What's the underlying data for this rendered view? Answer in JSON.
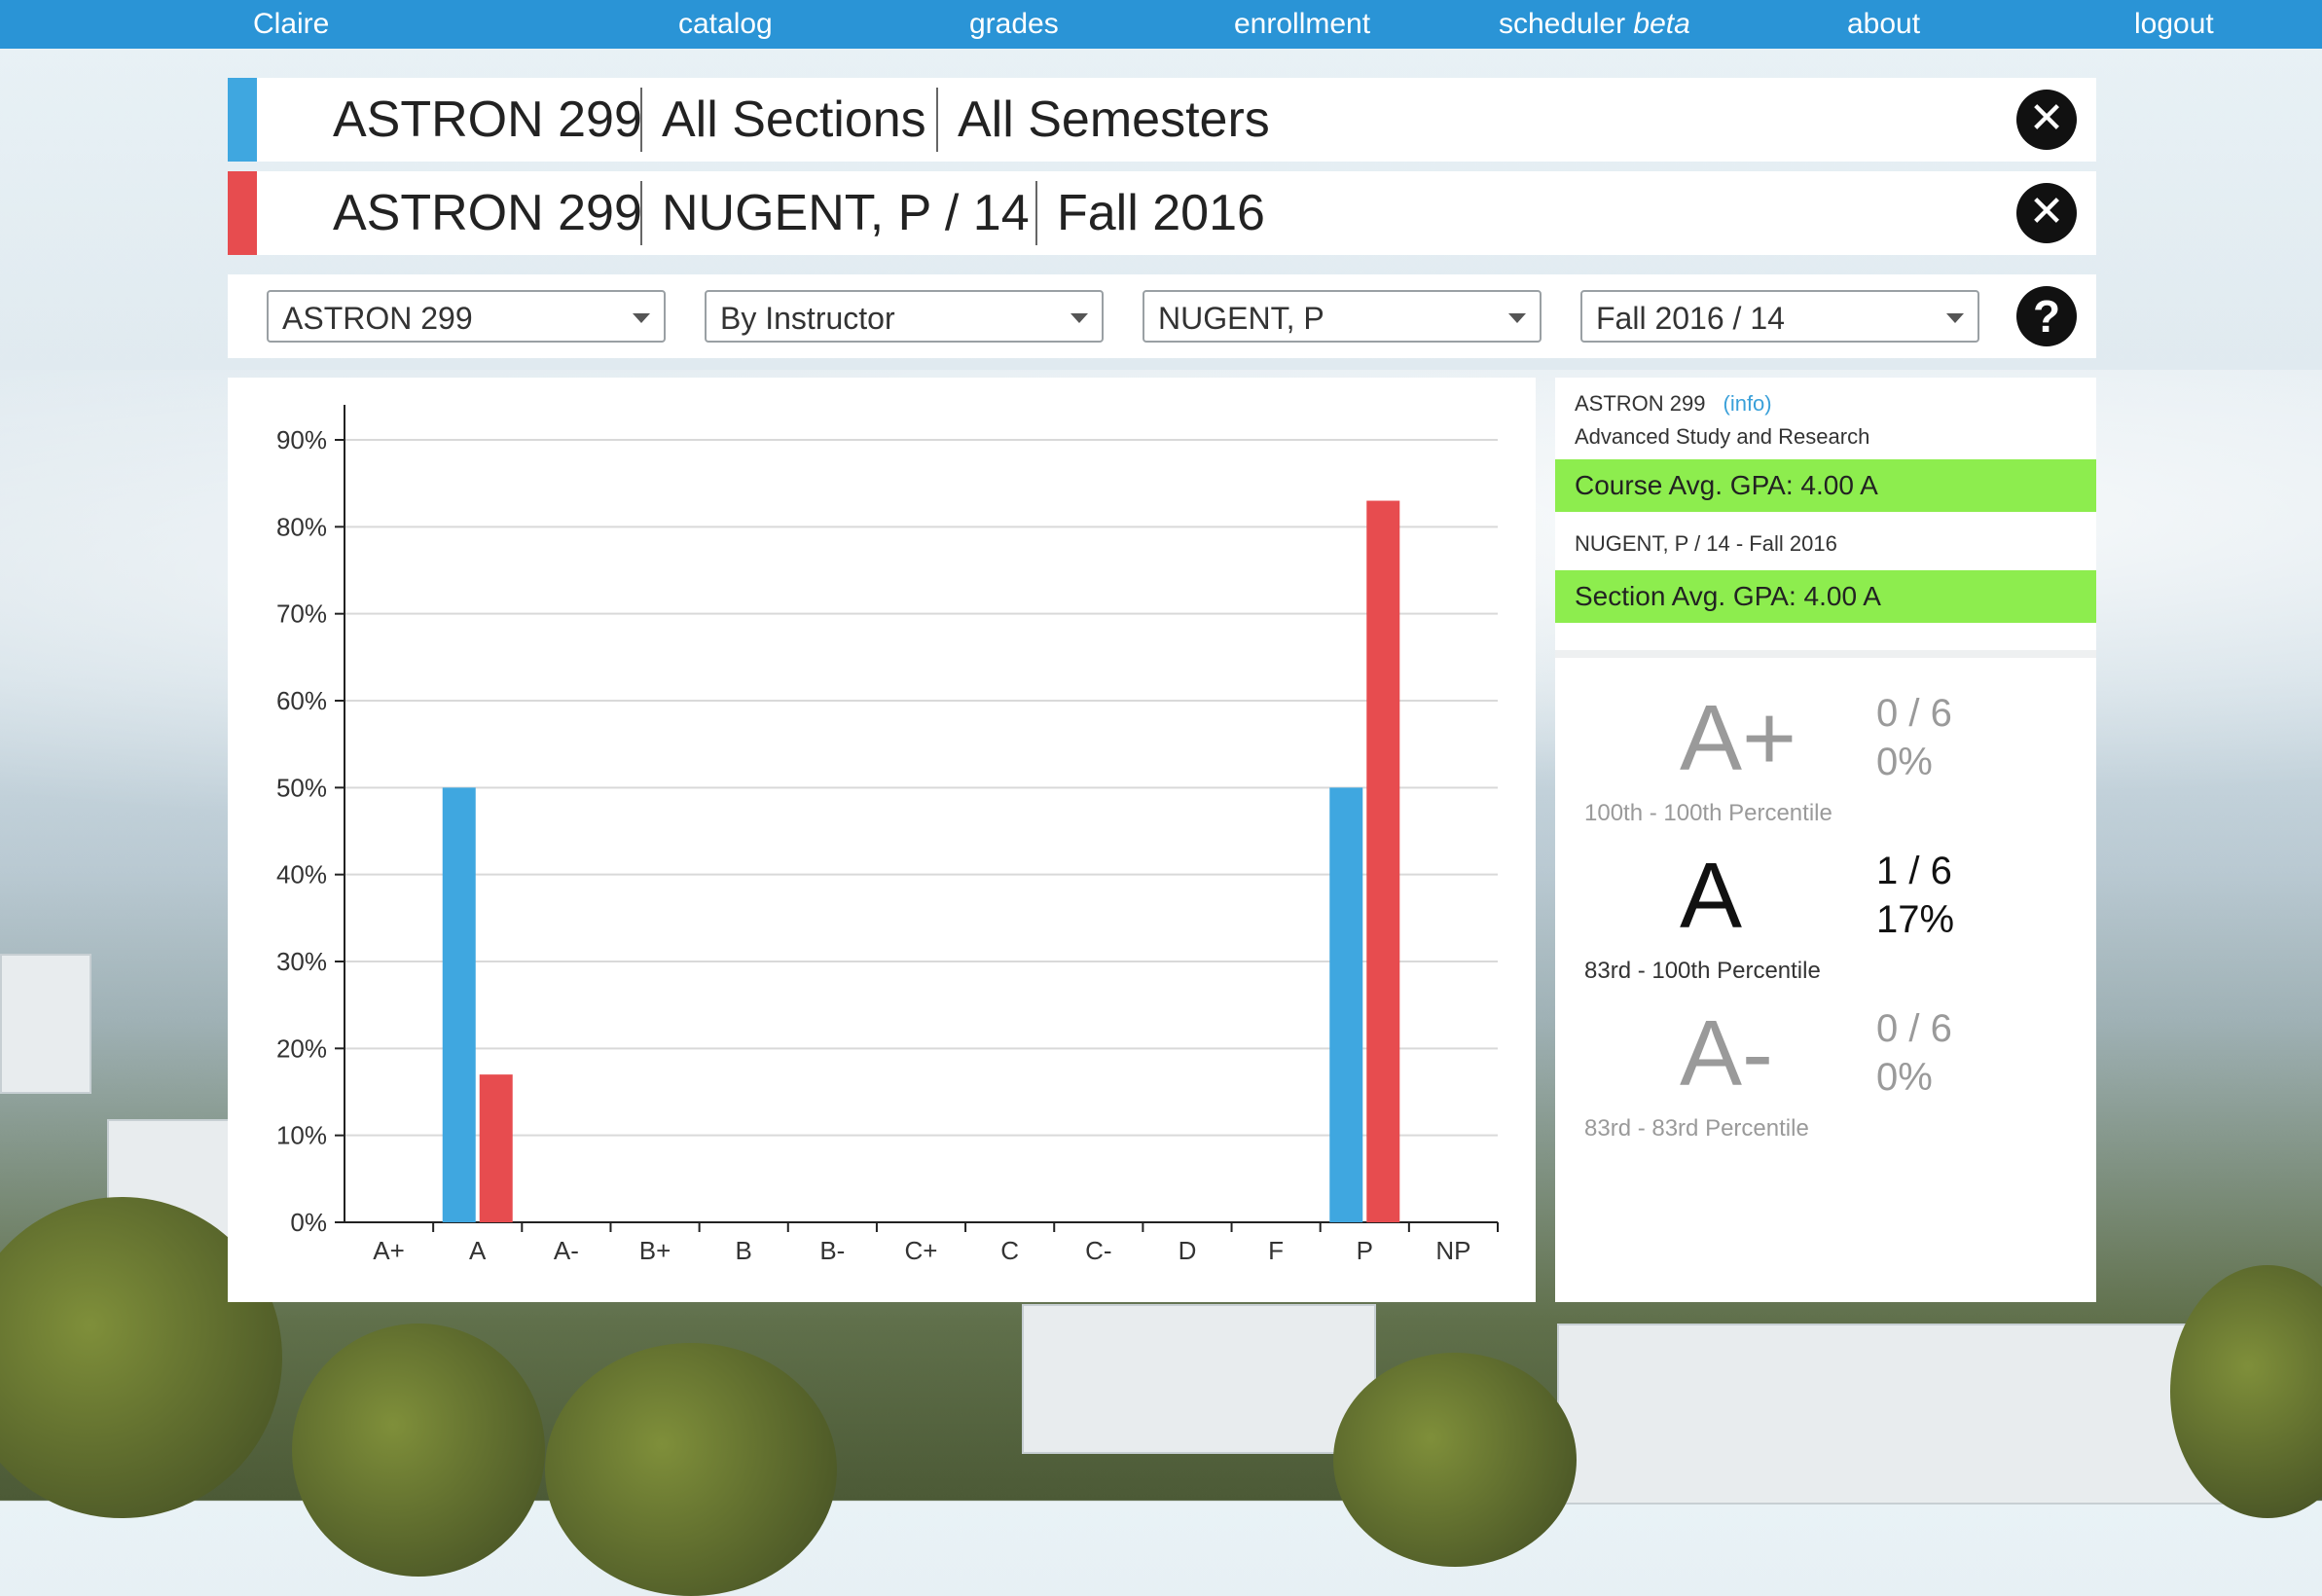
{
  "nav": {
    "brand": "Claire",
    "items": [
      "catalog",
      "grades",
      "enrollment"
    ],
    "scheduler": "scheduler",
    "scheduler_tag": "beta",
    "about": "about",
    "logout": "logout"
  },
  "filters": [
    {
      "color": "#3fa7e0",
      "course": "ASTRON 299",
      "section": "All Sections",
      "semester": "All Semesters"
    },
    {
      "color": "#e74c4f",
      "course": "ASTRON 299",
      "section": "NUGENT, P / 14",
      "semester": "Fall 2016"
    }
  ],
  "controls": {
    "course": "ASTRON 299",
    "mode": "By Instructor",
    "instructor": "NUGENT, P",
    "semester_section": "Fall 2016 / 14",
    "help": "?"
  },
  "info": {
    "course_code": "ASTRON 299",
    "info_link": "(info)",
    "course_title": "Advanced Study and Research",
    "course_gpa": "Course Avg. GPA:  4.00  A",
    "section_label": "NUGENT, P / 14 - Fall 2016",
    "section_gpa": "Section Avg. GPA:  4.00  A"
  },
  "distribution": [
    {
      "grade": "A+",
      "percentile": "100th  -  100th Percentile",
      "count": "0 / 6",
      "pct": "0%",
      "active": false
    },
    {
      "grade": "A",
      "percentile": "83rd  -  100th Percentile",
      "count": "1 / 6",
      "pct": "17%",
      "active": true
    },
    {
      "grade": "A-",
      "percentile": "83rd  -  83rd Percentile",
      "count": "0 / 6",
      "pct": "0%",
      "active": false
    }
  ],
  "chart_data": {
    "type": "bar",
    "categories": [
      "A+",
      "A",
      "A-",
      "B+",
      "B",
      "B-",
      "C+",
      "C",
      "C-",
      "D",
      "F",
      "P",
      "NP"
    ],
    "series": [
      {
        "values": [
          0,
          50,
          0,
          0,
          0,
          0,
          0,
          0,
          0,
          0,
          0,
          50,
          0
        ],
        "color": "#3fa7e0"
      },
      {
        "values": [
          0,
          17,
          0,
          0,
          0,
          0,
          0,
          0,
          0,
          0,
          0,
          83,
          0
        ],
        "color": "#e74c4f"
      }
    ],
    "yticks": [
      "0%",
      "10%",
      "20%",
      "30%",
      "40%",
      "50%",
      "60%",
      "70%",
      "80%",
      "90%"
    ],
    "ylim": [
      0,
      90
    ],
    "grid": true
  }
}
